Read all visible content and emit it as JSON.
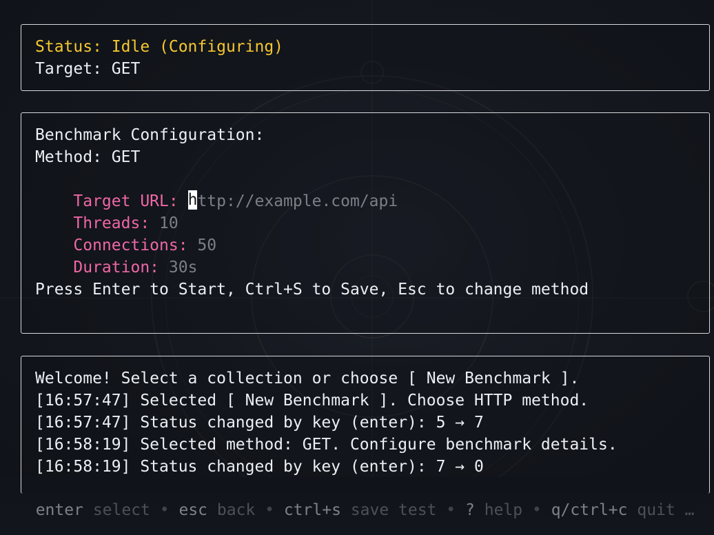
{
  "status_panel": {
    "status_line": "Status: Idle (Configuring)",
    "target_line": "Target: GET"
  },
  "config_panel": {
    "heading": "Benchmark Configuration:",
    "method_line": "Method: GET",
    "fields": [
      {
        "label": "Target URL:",
        "cursor_char": "h",
        "value": "ttp://example.com/api",
        "focused": true
      },
      {
        "label": "Threads:",
        "value": "10"
      },
      {
        "label": "Connections:",
        "value": "50"
      },
      {
        "label": "Duration:",
        "value": "30s"
      }
    ],
    "hint": "Press Enter to Start, Ctrl+S to Save, Esc to change method"
  },
  "log_panel": {
    "lines": [
      "Welcome! Select a collection or choose [ New Benchmark ].",
      "[16:57:47] Selected [ New Benchmark ]. Choose HTTP method.",
      "[16:57:47] Status changed by key (enter): 5 → 7",
      "[16:58:19] Selected method: GET. Configure benchmark details.",
      "[16:58:19] Status changed by key (enter): 7 → 0"
    ]
  },
  "footer": {
    "items": [
      {
        "key": "enter",
        "desc": "select"
      },
      {
        "key": "esc",
        "desc": "back"
      },
      {
        "key": "ctrl+s",
        "desc": "save test"
      },
      {
        "key": "?",
        "desc": "help"
      },
      {
        "key": "q/ctrl+c",
        "desc": "quit"
      }
    ],
    "separator": "•",
    "ellipsis": "…"
  },
  "colors": {
    "accent_yellow": "#f5c730",
    "label_pink": "#ef67a6",
    "placeholder_gray": "#7c7f87",
    "border": "#d8d9dc",
    "background": "#11141b"
  }
}
